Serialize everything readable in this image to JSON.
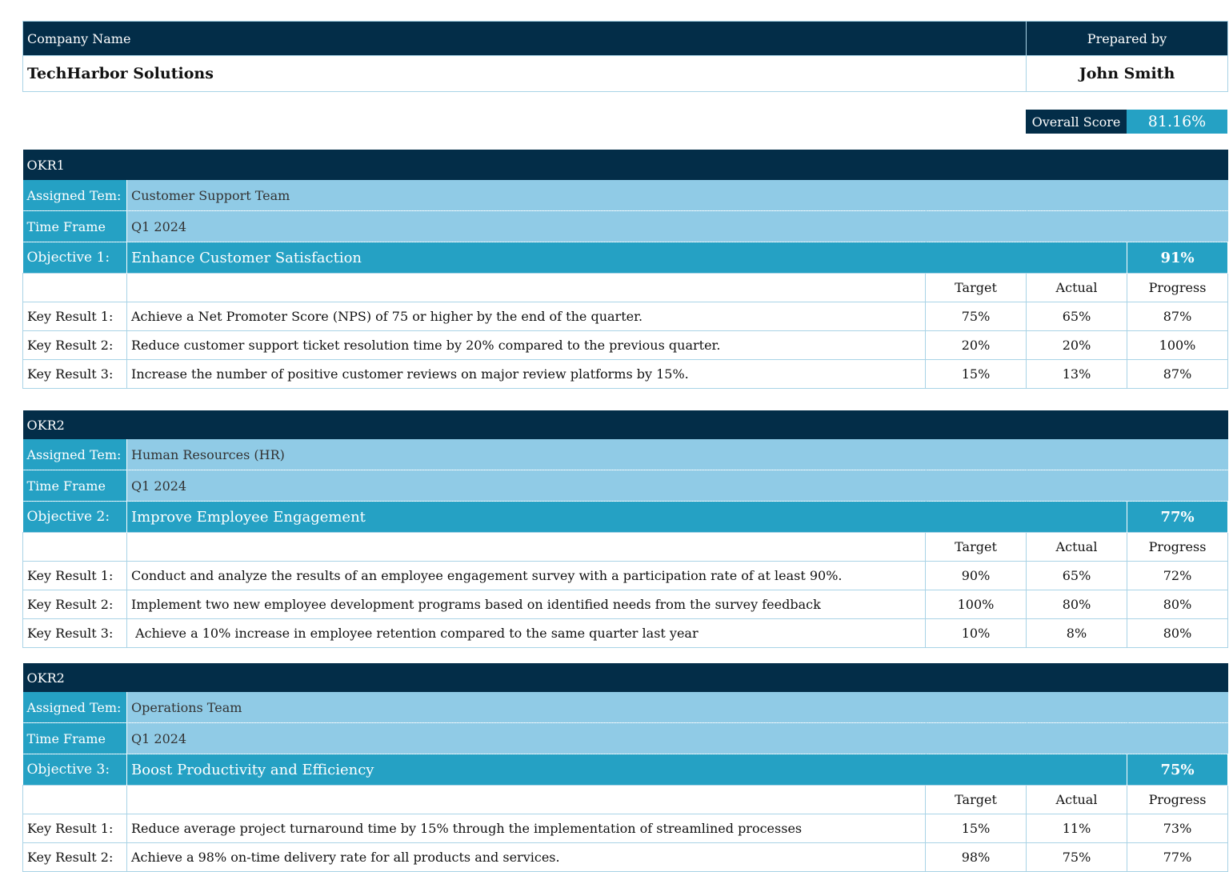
{
  "header": {
    "company_label": "Company Name",
    "company_value": "TechHarbor Solutions",
    "prepared_label": "Prepared by",
    "prepared_value": "John Smith"
  },
  "overall": {
    "label": "Overall Score",
    "value": "81.16%"
  },
  "labels": {
    "assigned": "Assigned Tem:",
    "time_frame": "Time Frame",
    "target": "Target",
    "actual": "Actual",
    "progress": "Progress"
  },
  "okrs": [
    {
      "title": "OKR1",
      "team": "Customer Support Team",
      "time_frame": "Q1 2024",
      "objective_label": "Objective 1:",
      "objective": "Enhance Customer Satisfaction",
      "progress": "91%",
      "key_results": [
        {
          "label": "Key Result 1:",
          "text": "Achieve a Net Promoter Score (NPS) of 75 or higher by the end of the quarter.",
          "target": "75%",
          "actual": "65%",
          "progress": "87%"
        },
        {
          "label": "Key Result 2:",
          "text": "Reduce customer support ticket resolution time by 20% compared to the previous quarter.",
          "target": "20%",
          "actual": "20%",
          "progress": "100%"
        },
        {
          "label": "Key Result 3:",
          "text": "Increase the number of positive customer reviews on major review platforms by 15%.",
          "target": "15%",
          "actual": "13%",
          "progress": "87%"
        }
      ]
    },
    {
      "title": "OKR2",
      "team": "Human Resources (HR)",
      "time_frame": "Q1 2024",
      "objective_label": "Objective 2:",
      "objective": "Improve Employee Engagement",
      "progress": "77%",
      "key_results": [
        {
          "label": "Key Result 1:",
          "text": "Conduct and analyze the results of an employee engagement survey with a participation rate of at least 90%.",
          "target": "90%",
          "actual": "65%",
          "progress": "72%"
        },
        {
          "label": "Key Result 2:",
          "text": "Implement two new employee development programs based on identified needs from the survey feedback",
          "target": "100%",
          "actual": "80%",
          "progress": "80%"
        },
        {
          "label": "Key Result 3:",
          "text": " Achieve a 10% increase in employee retention compared to the same quarter last year",
          "target": "10%",
          "actual": "8%",
          "progress": "80%"
        }
      ]
    },
    {
      "title": "OKR2",
      "team": "Operations Team",
      "time_frame": "Q1 2024",
      "objective_label": "Objective 3:",
      "objective": "Boost Productivity and Efficiency",
      "progress": "75%",
      "key_results": [
        {
          "label": "Key Result 1:",
          "text": "Reduce average project turnaround time by 15% through the implementation of streamlined processes",
          "target": "15%",
          "actual": "11%",
          "progress": "73%"
        },
        {
          "label": "Key Result 2:",
          "text": "Achieve a 98% on-time delivery rate for all products and services.",
          "target": "98%",
          "actual": "75%",
          "progress": "77%"
        }
      ]
    }
  ]
}
